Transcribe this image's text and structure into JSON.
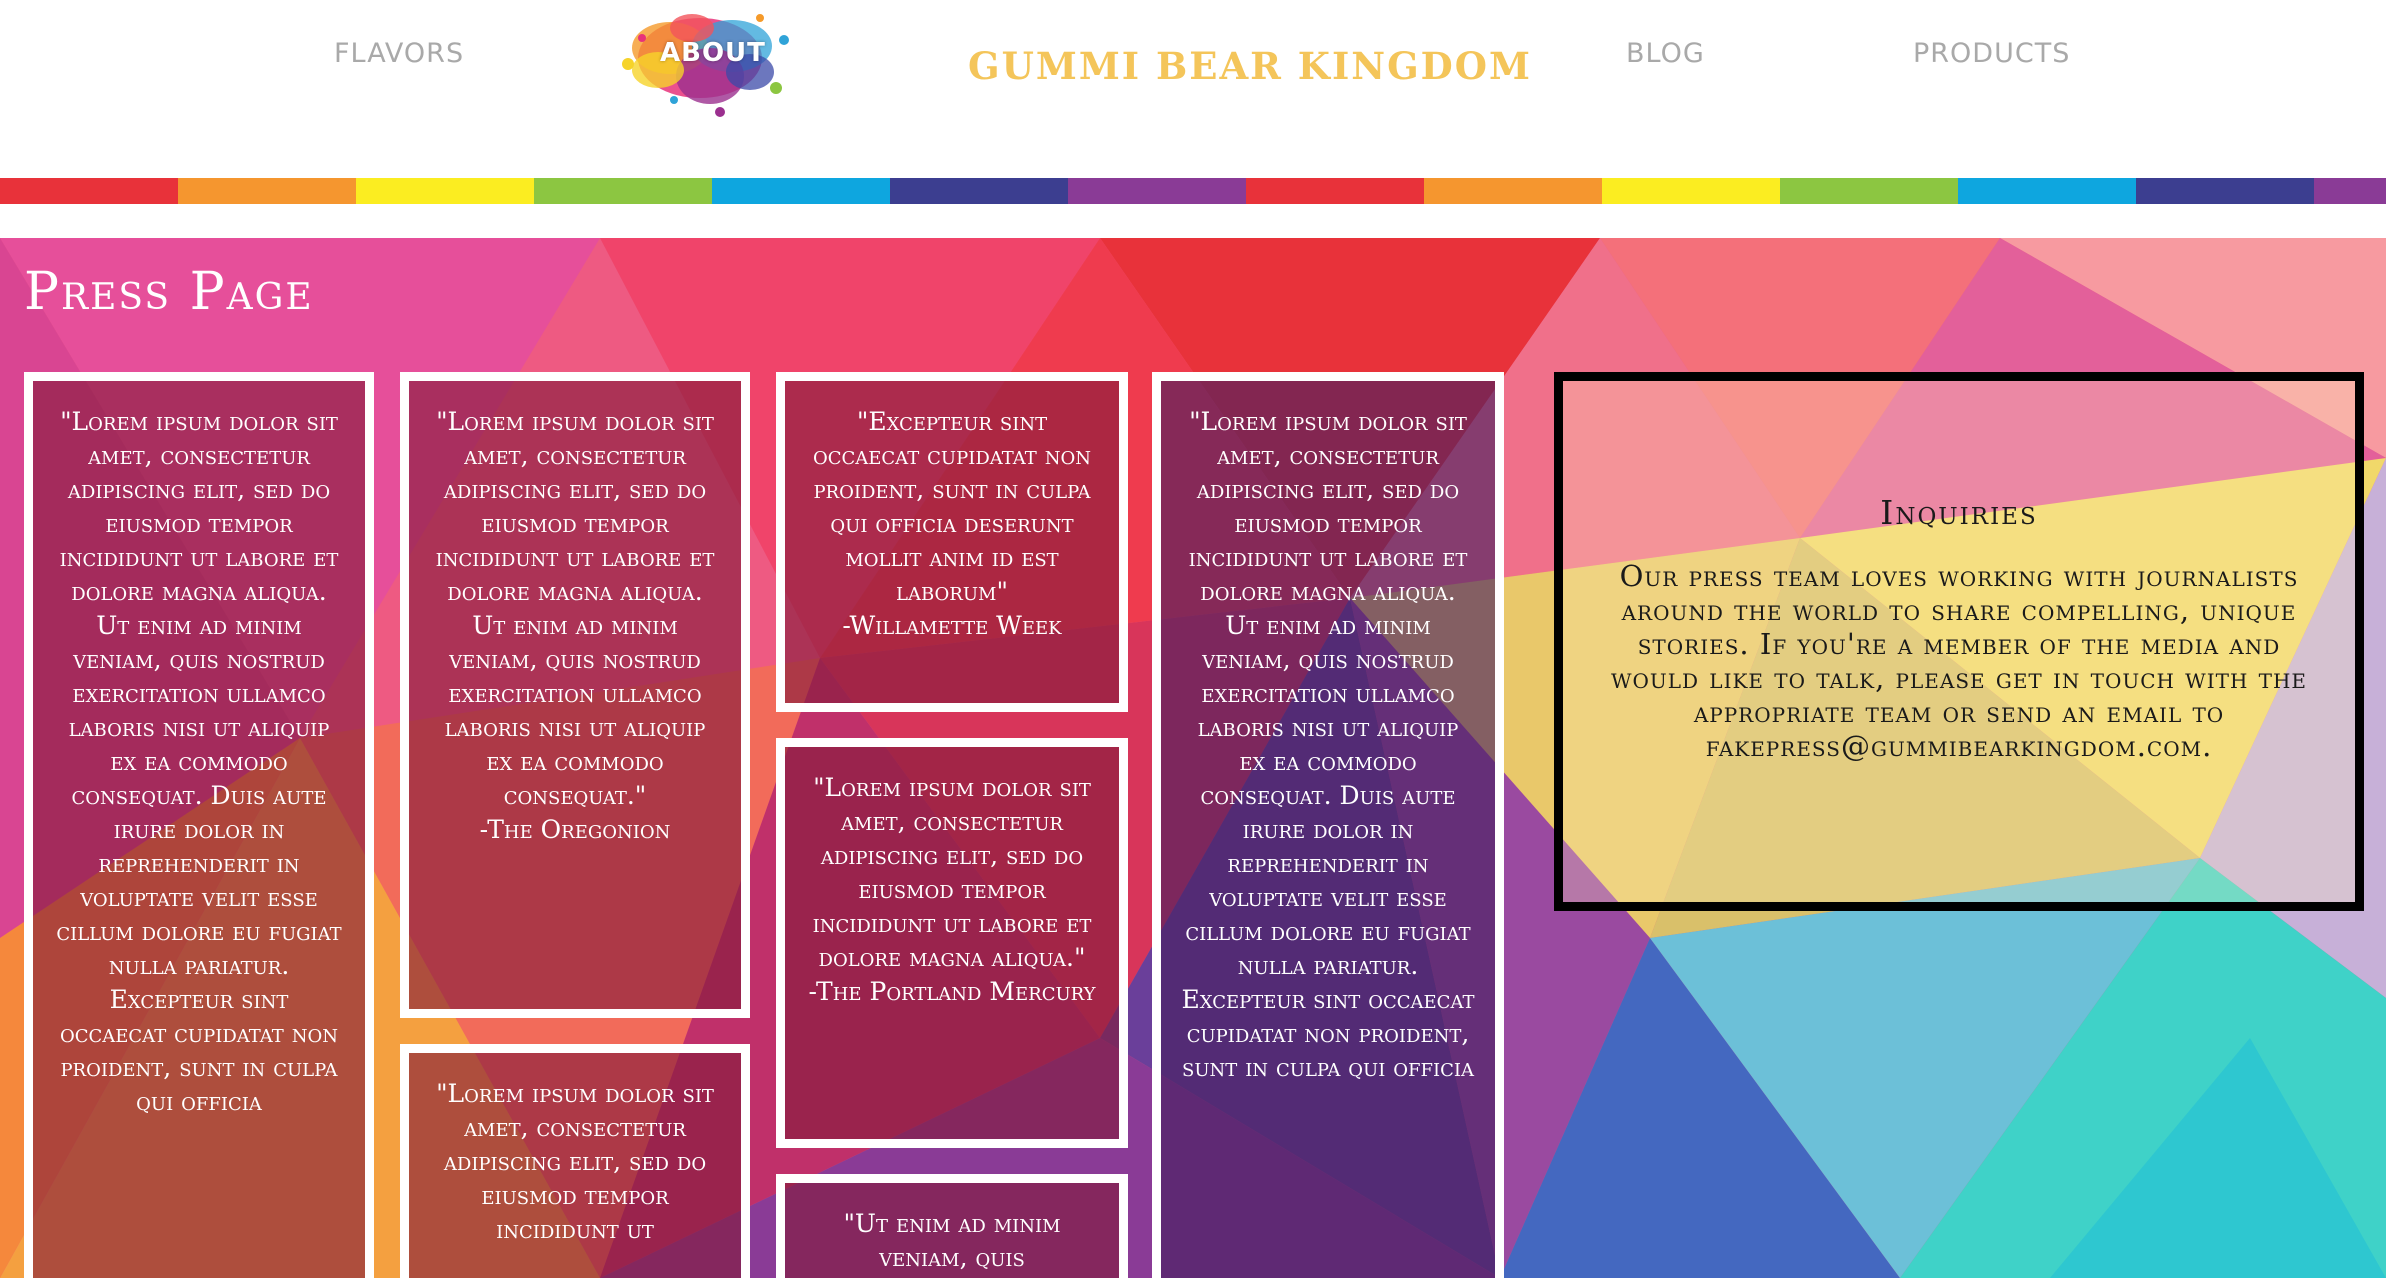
{
  "nav": {
    "flavors": "FLAVORS",
    "about": "ABOUT",
    "brand": "GUMMI BEAR KINGDOM",
    "blog": "BLOG",
    "products": "PRODUCTS"
  },
  "colors": {
    "nav_text": "#a9a9a9",
    "brand": "#f4c55a",
    "rainbow": [
      "#e8323a",
      "#f5962f",
      "#fbed21",
      "#8cc641",
      "#0ea6df",
      "#3c3e90",
      "#8a3b96"
    ]
  },
  "page_title": "Press Page",
  "cards": [
    {
      "quote": "\"Lorem ipsum dolor sit amet, consectetur adipiscing elit, sed do eiusmod tempor incididunt ut labore et dolore magna aliqua. Ut enim ad minim veniam, quis nostrud exercitation ullamco laboris nisi ut aliquip ex ea commodo consequat. Duis aute irure dolor in reprehenderit in voluptate velit esse cillum dolore eu fugiat nulla pariatur. Excepteur sint occaecat cupidatat non proident, sunt in culpa qui officia",
      "source": ""
    },
    {
      "quote": "\"Lorem ipsum dolor sit amet, consectetur adipiscing elit, sed do eiusmod tempor incididunt ut labore et dolore magna aliqua. Ut enim ad minim veniam, quis nostrud exercitation ullamco laboris nisi ut aliquip ex ea commodo consequat.\"",
      "source": "-The Oregonion"
    },
    {
      "quote": "\"Lorem ipsum dolor sit amet, consectetur adipiscing elit, sed do eiusmod tempor incididunt ut",
      "source": ""
    },
    {
      "quote": "\"Excepteur sint occaecat cupidatat non proident, sunt in culpa qui officia deserunt mollit anim id est laborum\"",
      "source": "-Willamette Week"
    },
    {
      "quote": "\"Lorem ipsum dolor sit amet, consectetur adipiscing elit, sed do eiusmod tempor incididunt ut labore et dolore magna aliqua.\"",
      "source": "-The Portland Mercury"
    },
    {
      "quote": "\"Ut enim ad minim veniam, quis",
      "source": ""
    },
    {
      "quote": "\"Lorem ipsum dolor sit amet, consectetur adipiscing elit, sed do eiusmod tempor incididunt ut labore et dolore magna aliqua. Ut enim ad minim veniam, quis nostrud exercitation ullamco laboris nisi ut aliquip ex ea commodo consequat. Duis aute irure dolor in reprehenderit in voluptate velit esse cillum dolore eu fugiat nulla pariatur. Excepteur sint occaecat cupidatat non proident, sunt in culpa qui officia",
      "source": ""
    }
  ],
  "inquiries": {
    "title": "Inquiries",
    "body": "Our press team loves working with journalists around the world to share compelling, unique stories. If you're a member of the media and would like to talk, please get in touch with the appropriate team or send an email to fakepress@gummibearkingdom.com."
  }
}
